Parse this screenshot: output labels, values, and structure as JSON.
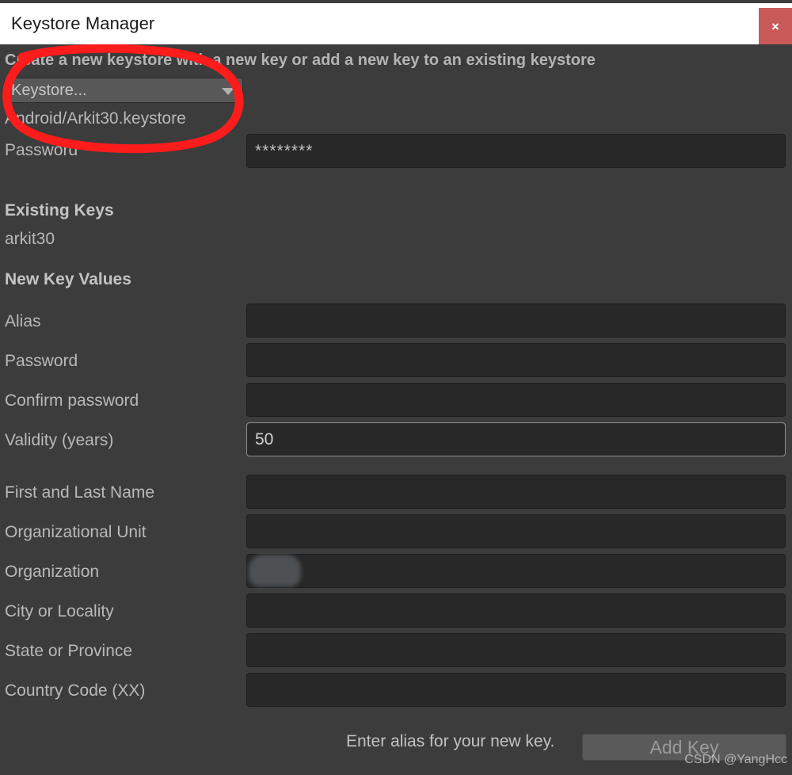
{
  "window": {
    "title": "Keystore Manager",
    "close_icon": "close-icon",
    "close_label": "×"
  },
  "header": {
    "hint": "Create a new keystore with a new key or add a new key to an existing keystore"
  },
  "keystore": {
    "dropdown_label": "Keystore...",
    "dropdown_icon": "chevron-down-icon",
    "path": "Android/Arkit30.keystore",
    "password_label": "Password",
    "password_value": "********"
  },
  "existing_keys": {
    "heading": "Existing Keys",
    "items": [
      "arkit30"
    ]
  },
  "new_key_values": {
    "heading": "New Key Values",
    "fields": [
      {
        "label": "Alias",
        "value": "",
        "placeholder": "",
        "focused": false
      },
      {
        "label": "Password",
        "value": "",
        "placeholder": "",
        "focused": false
      },
      {
        "label": "Confirm password",
        "value": "",
        "placeholder": "",
        "focused": false
      },
      {
        "label": "Validity (years)",
        "value": "50",
        "placeholder": "",
        "focused": true
      },
      {
        "label": "First and Last Name",
        "value": "",
        "placeholder": "",
        "focused": false
      },
      {
        "label": "Organizational Unit",
        "value": "",
        "placeholder": "",
        "focused": false
      },
      {
        "label": "Organization",
        "value": "",
        "placeholder": "",
        "focused": false
      },
      {
        "label": "City or Locality",
        "value": "",
        "placeholder": "",
        "focused": false
      },
      {
        "label": "State or Province",
        "value": "",
        "placeholder": "",
        "focused": false
      },
      {
        "label": "Country Code (XX)",
        "value": "",
        "placeholder": "",
        "focused": false
      }
    ],
    "organization_redacted_value": "S"
  },
  "footer": {
    "message": "Enter alias for your new key.",
    "add_key_label": "Add Key"
  },
  "watermark": {
    "text": "CSDN @YangHcc"
  },
  "colors": {
    "background": "#3c3c3c",
    "titlebar": "#ffffff",
    "close_button": "#c85a5a",
    "field_bg": "#282828",
    "dropdown_bg": "#585858",
    "text": "#b9b9b9",
    "annotation": "#fc1c1c"
  }
}
